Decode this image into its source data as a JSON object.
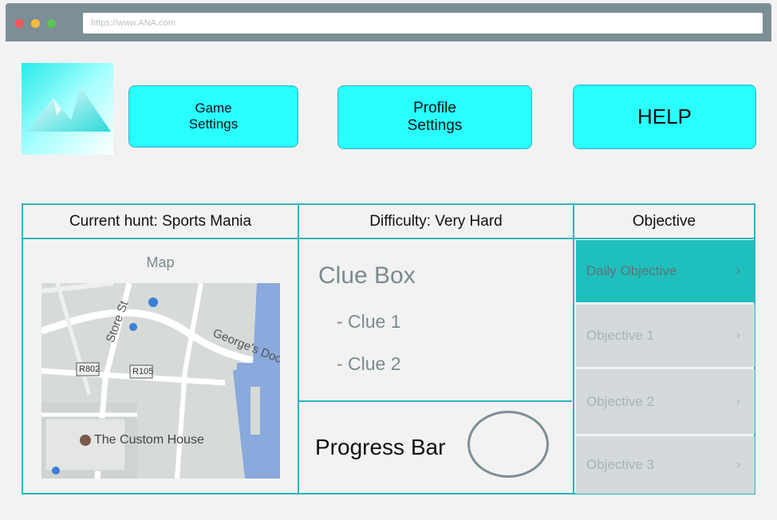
{
  "browser": {
    "url": "https://www.ANA.com"
  },
  "header": {
    "buttons": {
      "game_settings": "Game\nSettings",
      "profile_settings": "Profile\nSettings",
      "help": "HELP"
    }
  },
  "panel": {
    "current_hunt": "Current hunt: Sports Mania",
    "difficulty": "Difficulty: Very Hard",
    "objective_header": "Objective",
    "map_label": "Map",
    "map_labels": {
      "street_1": "Store St",
      "street_2": "George's Dock",
      "road_1": "R802",
      "road_2": "R105",
      "landmark": "The Custom House"
    },
    "clue_box": {
      "title": "Clue Box",
      "clues": [
        "- Clue 1",
        "- Clue 2"
      ]
    },
    "progress_label": "Progress Bar",
    "objectives": [
      {
        "label": "Daily Objective"
      },
      {
        "label": "Objective 1"
      },
      {
        "label": "Objective 2"
      },
      {
        "label": "Objective 3"
      }
    ]
  },
  "colors": {
    "accent_cyan": "#29ffff",
    "border_teal": "#2cb6bd",
    "active_objective": "#1fbfbd"
  }
}
